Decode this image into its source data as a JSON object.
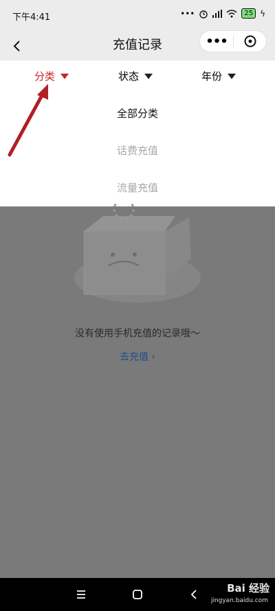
{
  "status_bar": {
    "time": "下午4:41",
    "battery": "25"
  },
  "nav": {
    "title": "充值记录",
    "more_label": "•••"
  },
  "filters": [
    {
      "label": "分类",
      "active": true
    },
    {
      "label": "状态",
      "active": false
    },
    {
      "label": "年份",
      "active": false
    }
  ],
  "dropdown": {
    "options": [
      "全部分类",
      "话费充值",
      "流量充值"
    ],
    "selected": "全部分类"
  },
  "empty_state": {
    "message": "没有使用手机充值的记录哦～",
    "link_label": "去充值"
  },
  "watermark": {
    "brand": "Bai 经验",
    "url": "jingyan.baidu.com"
  },
  "colors": {
    "accent": "#c3272b",
    "link": "#1e4f86",
    "overlay": "#7a7a7a"
  }
}
